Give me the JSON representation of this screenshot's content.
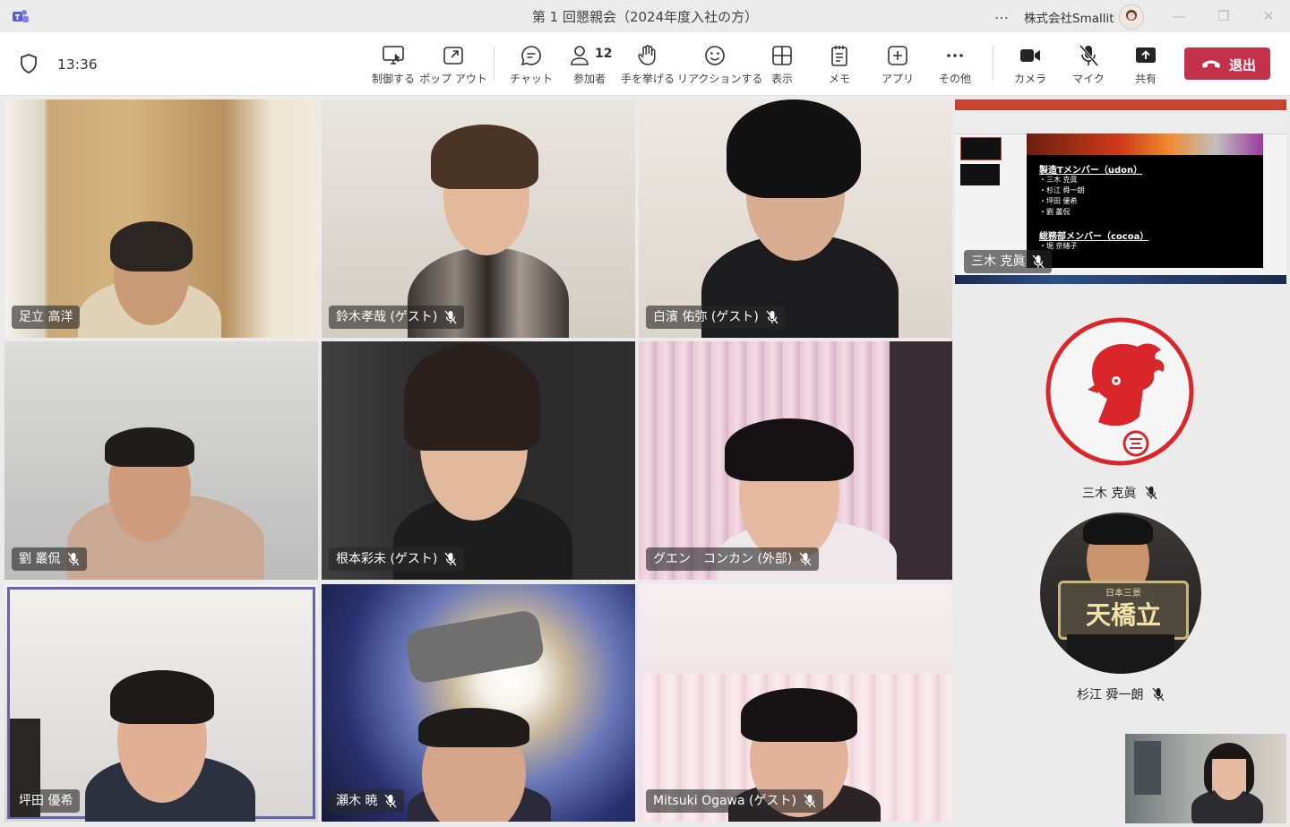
{
  "window": {
    "title": "第 1 回懇親会（2024年度入社の方）",
    "more": "…",
    "org": "株式会社Smallit"
  },
  "toolbar": {
    "timer": "13:36",
    "buttons": {
      "control": "制御する",
      "popout": "ポップ アウト",
      "chat": "チャット",
      "people": "参加者",
      "people_count": "12",
      "raise_hand": "手を挙げる",
      "react": "リアクションする",
      "view": "表示",
      "notes": "メモ",
      "apps": "アプリ",
      "more": "その他",
      "camera": "カメラ",
      "mic": "マイク",
      "share": "共有",
      "leave": "退出"
    }
  },
  "participants": [
    {
      "name": "足立 高洋",
      "muted": false
    },
    {
      "name": "鈴木孝哉 (ゲスト)",
      "muted": true
    },
    {
      "name": "白濱 佑弥 (ゲスト)",
      "muted": true
    },
    {
      "name": "劉 叢侃",
      "muted": true
    },
    {
      "name": "根本彩未 (ゲスト)",
      "muted": true
    },
    {
      "name": "グエン　コンカン (外部)",
      "muted": true
    },
    {
      "name": "坪田 優希",
      "muted": false,
      "speaking": true
    },
    {
      "name": "瀬木 暁",
      "muted": true
    },
    {
      "name": "Mitsuki Ogawa (ゲスト)",
      "muted": true
    }
  ],
  "screen_share": {
    "presenter": "三木 克眞",
    "slide_heading1": "製造Tメンバー（udon）",
    "slide_members1": [
      "・三木 克眞",
      "・杉江 舜一朗",
      "・坪田 優希",
      "・劉 叢侃"
    ],
    "slide_heading2": "総務部メンバー（cocoa）",
    "slide_members2": [
      "・堀 奈緒子"
    ]
  },
  "side_participants": [
    {
      "name": "三木 克眞",
      "muted": true
    },
    {
      "name": "杉江 舜一朗",
      "muted": true
    }
  ],
  "sign_text": {
    "small": "日本三景",
    "big": "天橋立"
  },
  "colors": {
    "accent": "#6264a7",
    "leave": "#c4314b",
    "rooster_red": "#d9262b"
  }
}
